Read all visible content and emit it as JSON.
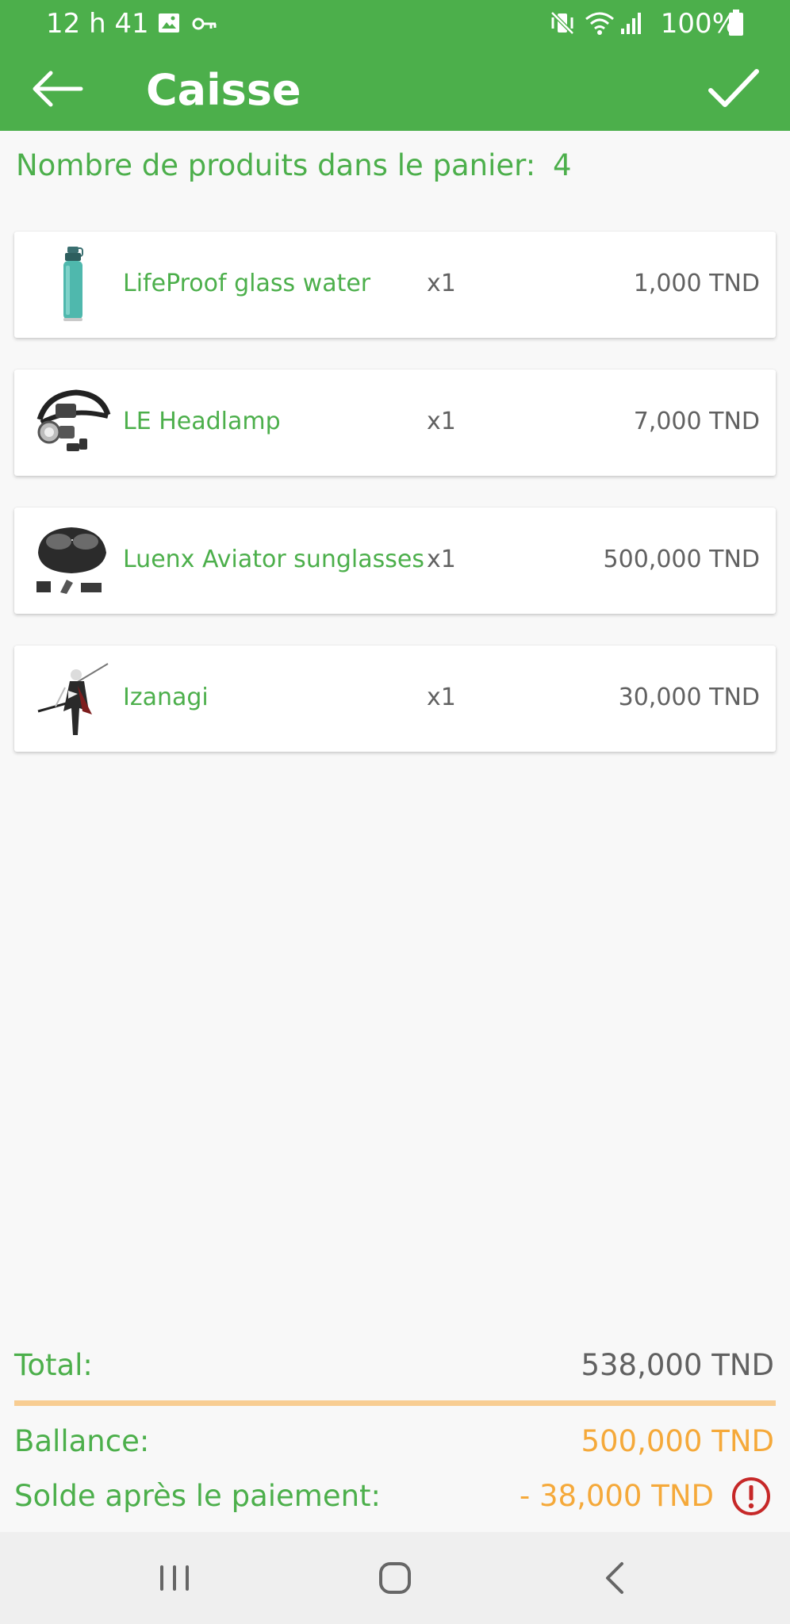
{
  "status_bar": {
    "time": "12 h 41",
    "battery_percent": "100%",
    "icons": [
      "image-icon",
      "key-icon",
      "vibrate-mute-icon",
      "wifi-icon",
      "signal-icon",
      "battery-icon"
    ]
  },
  "app_bar": {
    "title": "Caisse",
    "back_icon": "back-arrow-icon",
    "confirm_icon": "check-icon"
  },
  "cart": {
    "count_label": "Nombre de produits dans le panier:",
    "count": "4"
  },
  "items": [
    {
      "name": "LifeProof glass water",
      "qty": "x1",
      "price": "1,000 TND",
      "icon": "water-bottle-image"
    },
    {
      "name": "LE Headlamp",
      "qty": "x1",
      "price": "7,000 TND",
      "icon": "headlamp-image"
    },
    {
      "name": "Luenx Aviator sunglasses",
      "qty": "x1",
      "price": "500,000 TND",
      "icon": "sunglasses-image"
    },
    {
      "name": "Izanagi",
      "qty": "x1",
      "price": "30,000 TND",
      "icon": "figure-image"
    }
  ],
  "summary": {
    "total_label": "Total:",
    "total_value": "538,000 TND",
    "balance_label": "Ballance:",
    "balance_value": "500,000 TND",
    "after_label": "Solde après le paiement:",
    "after_value": "- 38,000 TND",
    "warning_icon": "alert-circle-icon"
  },
  "colors": {
    "primary_green": "#4caf4b",
    "orange": "#f5a93a",
    "divider": "#f8cd92",
    "warning_red": "#c62828",
    "text_gray": "#616161"
  },
  "nav_bar": [
    "recent-apps-icon",
    "home-icon",
    "back-icon"
  ]
}
